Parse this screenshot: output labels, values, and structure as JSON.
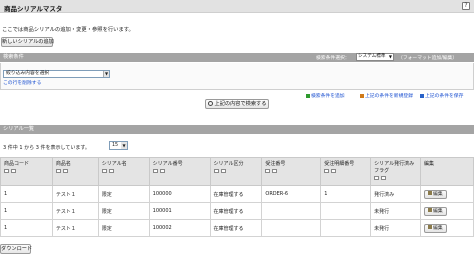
{
  "header": {
    "title": "商品シリアルマスタ",
    "help_glyph": "?"
  },
  "description": "ここでは商品シリアルの追加・変更・参照を行います。",
  "toolbar": {
    "new_button": "新しいシリアルの追加"
  },
  "conditions": {
    "section_title": "検索条件",
    "select_label": "検索条件選択：",
    "select_value": "システム標準",
    "format_link": "フォーマット追加/編集",
    "dropdown_value": "絞り込み内容を選択",
    "delete_link": "この行を削除する",
    "search_button": "上記の内容で検索する",
    "actions": [
      "検索条件を追加",
      "上記の条件を新規登録",
      "上記の条件を保存"
    ]
  },
  "list": {
    "section_title": "シリアル一覧",
    "count_text": "3 件中 1 から 3 件を表示しています。",
    "per_page": "15",
    "columns": [
      "商品コード",
      "商品名",
      "シリアル名",
      "シリアル番号",
      "シリアル区分",
      "受注番号",
      "受注明細番号",
      "シリアル発行済み\nフラグ",
      "編集"
    ],
    "rows": [
      [
        "1",
        "テスト１",
        "限定",
        "100000",
        "在庫管理する",
        "ORDER-6",
        "1",
        "発行済み",
        "編集"
      ],
      [
        "1",
        "テスト１",
        "限定",
        "100001",
        "在庫管理する",
        "",
        "",
        "未発行",
        "編集"
      ],
      [
        "1",
        "テスト１",
        "限定",
        "100002",
        "在庫管理する",
        "",
        "",
        "未発行",
        "編集"
      ]
    ]
  },
  "footer": {
    "download_button": "ダウンロード"
  },
  "colors": {
    "section_bar": "#a4a4a4",
    "title_bar": "#e2e2e2",
    "link": "#1a4fd0"
  }
}
